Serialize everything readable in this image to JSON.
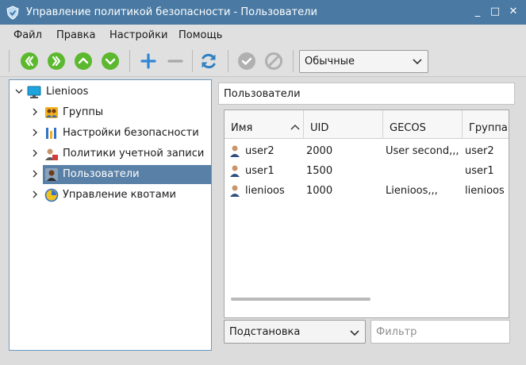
{
  "window": {
    "title": "Управление политикой безопасности - Пользователи",
    "buttons": {
      "minimize": "_",
      "maximize": "□",
      "close": "✕"
    }
  },
  "menubar": {
    "items": [
      "Файл",
      "Правка",
      "Настройки",
      "Помощь"
    ]
  },
  "toolbar": {
    "buttons": [
      {
        "icon": "double-left-arrow-icon",
        "color": "#5cb82e"
      },
      {
        "icon": "double-right-arrow-icon",
        "color": "#5cb82e"
      },
      {
        "icon": "arrow-up-icon",
        "color": "#5cb82e"
      },
      {
        "icon": "arrow-down-icon",
        "color": "#5cb82e"
      },
      {
        "icon": "plus-icon",
        "color": "#2f86d4"
      },
      {
        "icon": "minus-icon",
        "color": "#a8a8a8"
      },
      {
        "icon": "refresh-icon",
        "color": "#2f7fc1"
      },
      {
        "icon": "check-icon",
        "color": "#a8a8a8"
      },
      {
        "icon": "cancel-icon",
        "color": "#a8a8a8"
      }
    ],
    "mode_select": {
      "value": "Обычные"
    }
  },
  "tree": {
    "root": {
      "label": "Lienioos",
      "icon": "monitor-icon"
    },
    "items": [
      {
        "label": "Группы",
        "icon": "group-icon"
      },
      {
        "label": "Настройки безопасности",
        "icon": "security-settings-icon"
      },
      {
        "label": "Политики учетной записи",
        "icon": "account-policy-icon"
      },
      {
        "label": "Пользователи",
        "icon": "users-icon",
        "selected": true
      },
      {
        "label": "Управление квотами",
        "icon": "quota-icon"
      }
    ]
  },
  "content": {
    "section_title": "Пользователи",
    "table": {
      "columns": [
        "Имя",
        "UID",
        "GECOS",
        "Группа"
      ],
      "rows": [
        {
          "name": "user2",
          "uid": "2000",
          "gecos": "User second,,,",
          "group": "user2"
        },
        {
          "name": "user1",
          "uid": "1500",
          "gecos": "",
          "group": "user1"
        },
        {
          "name": "lienioos",
          "uid": "1000",
          "gecos": "Lienioos,,,",
          "group": "lienioos"
        }
      ]
    },
    "match_select": {
      "value": "Подстановка"
    },
    "filter": {
      "placeholder": "Фильтр",
      "value": ""
    }
  }
}
